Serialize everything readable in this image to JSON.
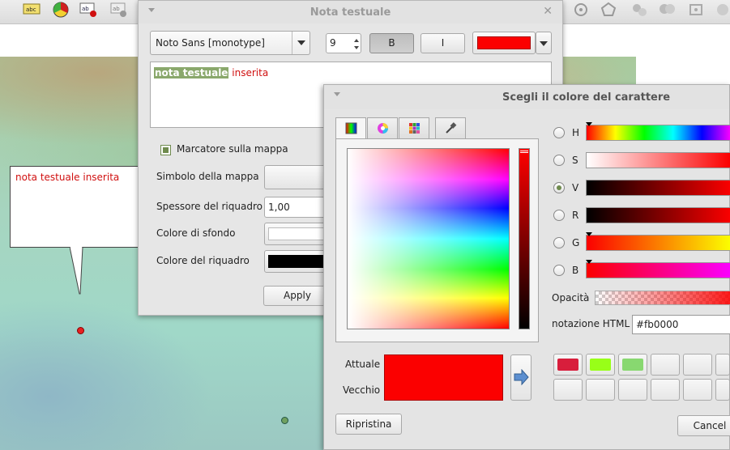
{
  "note_dialog": {
    "title": "Nota testuale",
    "font_family": "Noto Sans [monotype]",
    "font_size": "9",
    "bold_label": "B",
    "italic_label": "I",
    "text_color": "#fb0000",
    "editor_selected_text": "nota testuale",
    "editor_rest_text": " inserita",
    "marker_label": "Marcatore sulla mappa",
    "symbol_label": "Simbolo della mappa",
    "thickness_label": "Spessore del riquadro",
    "thickness_value": "1,00",
    "background_color_label": "Colore di sfondo",
    "border_color_label": "Colore del riquadro",
    "apply_label": "Apply"
  },
  "annotation": {
    "text": "nota testuale inserita"
  },
  "color_dialog": {
    "title": "Scegli il colore del carattere",
    "tabs": [
      {
        "icon": "color-square-icon"
      },
      {
        "icon": "color-wheel-icon"
      },
      {
        "icon": "swatch-grid-icon"
      },
      {
        "icon": "eyedropper-icon"
      }
    ],
    "channels": [
      "H",
      "S",
      "V",
      "R",
      "G",
      "B"
    ],
    "selected_channel": "V",
    "opacity_label": "Opacità",
    "html_label": "notazione HTML",
    "html_value": "#fb0000",
    "current_label": "Attuale",
    "old_label": "Vecchio",
    "current_color": "#fb0000",
    "swatches": [
      "#d81e3c",
      "#98ff18",
      "#88d870"
    ],
    "reset_label": "Ripristina",
    "cancel_label": "Cancel"
  }
}
